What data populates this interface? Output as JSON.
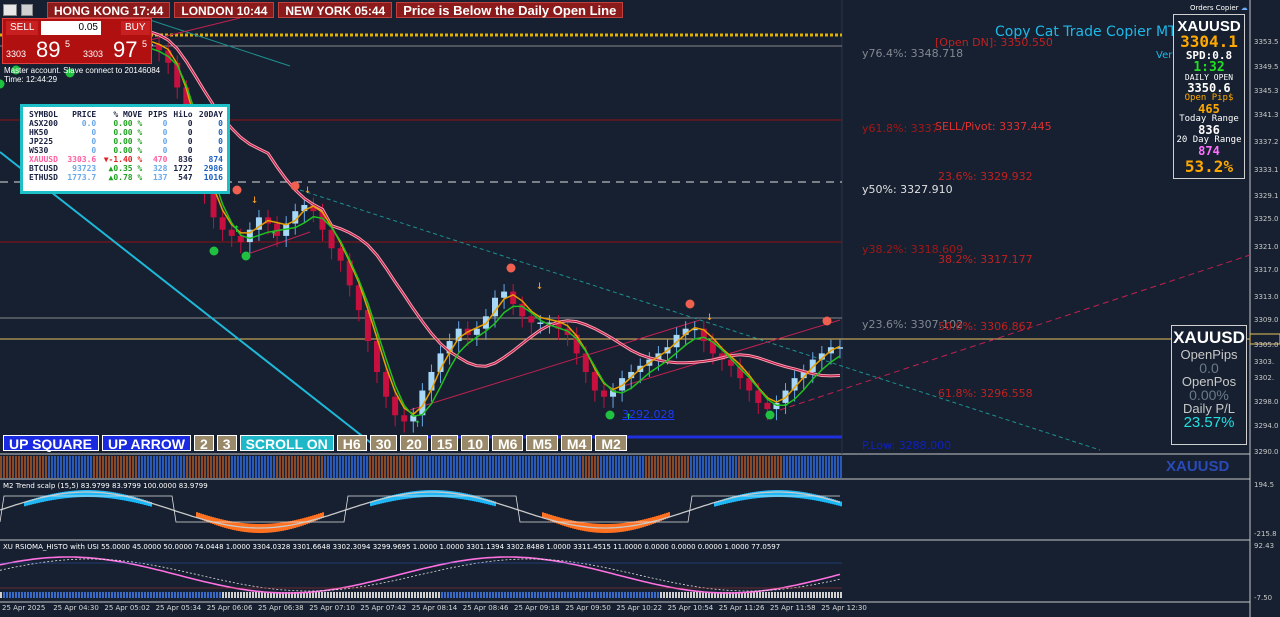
{
  "topbar": {
    "hong_kong": "HONG KONG 17:44",
    "london": "LONDON 10:44",
    "new_york": "NEW YORK 05:44",
    "alert": "Price is Below the Daily Open Line"
  },
  "trade_panel": {
    "sell_label": "SELL",
    "buy_label": "BUY",
    "lot": "0.05",
    "sell_big": "3303",
    "sell_pips": "89",
    "sell_sup": "5",
    "buy_big": "3303",
    "buy_pips": "97",
    "buy_sup": "5",
    "account_note": "Master account. Slave connect to 20146084",
    "time_note": "Time: 12:44:29"
  },
  "market_table": {
    "headers": [
      "SYMBOL",
      "PRICE",
      "% MOVE",
      "PIPS",
      "HiLo",
      "20DAY"
    ],
    "rows": [
      [
        "ASX200",
        "0.0",
        "0.00 %",
        "0",
        "0",
        "0"
      ],
      [
        "HK50",
        "0",
        "0.00 %",
        "0",
        "0",
        "0"
      ],
      [
        "JP225",
        "0",
        "0.00 %",
        "0",
        "0",
        "0"
      ],
      [
        "WS30",
        "0",
        "0.00 %",
        "0",
        "0",
        "0"
      ],
      [
        "XAUUSD",
        "3303.6",
        "▼-1.40 %",
        "470",
        "836",
        "874"
      ],
      [
        "BTCUSD",
        "93723",
        "▲0.35 %",
        "328",
        "1727",
        "2986"
      ],
      [
        "ETHUSD",
        "1773.7",
        "▲0.78 %",
        "137",
        "547",
        "1016"
      ]
    ]
  },
  "copier": {
    "orders_copier": "Orders Copier",
    "title": "Copy Cat Trade Copier MT5",
    "ver": "Ver"
  },
  "fib_labels": [
    {
      "text": "[Open DN]: 3350.550",
      "color": "#c02020"
    },
    {
      "text": "y76.4%: 3348.718",
      "color": "#808890"
    },
    {
      "text": "SELL/Pivot: 3337.445",
      "color": "#e03030"
    },
    {
      "text": "y61.8%: 3337.",
      "color": "#a01818"
    },
    {
      "text": "23.6%: 3329.932",
      "color": "#c02020"
    },
    {
      "text": "y50%: 3327.910",
      "color": "#e0e0e0"
    },
    {
      "text": "y38.2%: 3318.609",
      "color": "#a01818"
    },
    {
      "text": "38.2%: 3317.177",
      "color": "#c02020"
    },
    {
      "text": "y23.6%: 3307.102",
      "color": "#808890"
    },
    {
      "text": "50.0%: 3306.867",
      "color": "#c02020"
    },
    {
      "text": "61.8%: 3296.558",
      "color": "#c02020"
    },
    {
      "text": "P.Low: 3288.000",
      "color": "#1020c0"
    }
  ],
  "low_label": "3292.028",
  "buttons": [
    {
      "label": "UP SQUARE",
      "bg": "#1a2ae0"
    },
    {
      "label": "UP ARROW",
      "bg": "#1a2ae0"
    },
    {
      "label": "2",
      "bg": "#9a8a6a"
    },
    {
      "label": "3",
      "bg": "#9a8a6a"
    },
    {
      "label": "SCROLL ON",
      "bg": "#1eb8c8"
    },
    {
      "label": "H6",
      "bg": "#9a8a6a"
    },
    {
      "label": "30",
      "bg": "#9a8a6a"
    },
    {
      "label": "20",
      "bg": "#9a8a6a"
    },
    {
      "label": "15",
      "bg": "#9a8a6a"
    },
    {
      "label": "10",
      "bg": "#9a8a6a"
    },
    {
      "label": "M6",
      "bg": "#9a8a6a"
    },
    {
      "label": "M5",
      "bg": "#9a8a6a"
    },
    {
      "label": "M4",
      "bg": "#9a8a6a"
    },
    {
      "label": "M2",
      "bg": "#9a8a6a"
    }
  ],
  "info_panel": {
    "symbol": "XAUUSD",
    "price": "3304.1",
    "spread": "SPD:0.8",
    "timer": "1:32",
    "daily_open_label": "DAILY OPEN",
    "daily_open": "3350.6",
    "open_pips_label": "Open Pip$",
    "open_pips": "465",
    "today_range_label": "Today Range",
    "today_range": "836",
    "day20_label": "20 Day Range",
    "day20": "874",
    "percent": "53.2%"
  },
  "pos_panel": {
    "symbol": "XAUUSD",
    "open_pips_label": "OpenPips",
    "open_pips": "0.0",
    "open_pos_label": "OpenPos",
    "open_pos": "0.00%",
    "daily_pl_label": "Daily P/L",
    "daily_pl": "23.57%"
  },
  "watermark": "XAUUSD",
  "right_axis": [
    "3353.5",
    "3349.5",
    "3345.3",
    "3341.3",
    "3337.2",
    "3333.1",
    "3329.1",
    "3325.0",
    "3321.0",
    "3317.0",
    "3313.0",
    "3309.0",
    "3305.0",
    "3303.",
    "3302.",
    "3298.0",
    "3294.0",
    "3290.0"
  ],
  "time_axis": [
    "25 Apr 2025",
    "25 Apr 04:30",
    "25 Apr 05:02",
    "25 Apr 05:34",
    "25 Apr 06:06",
    "25 Apr 06:38",
    "25 Apr 07:10",
    "25 Apr 07:42",
    "25 Apr 08:14",
    "25 Apr 08:46",
    "25 Apr 09:18",
    "25 Apr 09:50",
    "25 Apr 10:22",
    "25 Apr 10:54",
    "25 Apr 11:26",
    "25 Apr 11:58",
    "25 Apr 12:30"
  ],
  "indicator1": {
    "title": "M2 Trend scalp (15,5) 83.9799 83.9799 100.0000 83.9799",
    "axis_top": "194.5",
    "axis_bottom": "-215.8"
  },
  "indicator2": {
    "title": "XU RSIOMA_HISTO with USI 55.0000 45.0000 50.0000 74.0448 1.0000 3304.0328 3301.6648 3302.3094 3299.9695 1.0000 1.0000 3301.1394 3302.8488 1.0000 3311.4515 11.0000 0.0000 0.0000 0.0000 1.0000 77.0597",
    "axis_top": "92.43",
    "axis_bottom": "-7.50"
  },
  "price_series": [
    3353,
    3352,
    3350,
    3346,
    3340,
    3334,
    3329,
    3325,
    3323,
    3322,
    3321,
    3323,
    3325,
    3324,
    3322,
    3324,
    3326,
    3327,
    3326,
    3323,
    3320,
    3318,
    3314,
    3310,
    3305,
    3300,
    3296,
    3293,
    3292,
    3293,
    3297,
    3300,
    3303,
    3305,
    3307,
    3306,
    3307,
    3309,
    3312,
    3313,
    3311,
    3309,
    3308,
    3308,
    3308,
    3307,
    3306,
    3303,
    3300,
    3297,
    3296,
    3297,
    3299,
    3300,
    3301,
    3302,
    3303,
    3304,
    3306,
    3307,
    3307,
    3305,
    3303,
    3302,
    3301,
    3299,
    3297,
    3295,
    3294,
    3295,
    3297,
    3299,
    3300,
    3302,
    3303,
    3304,
    3304
  ]
}
